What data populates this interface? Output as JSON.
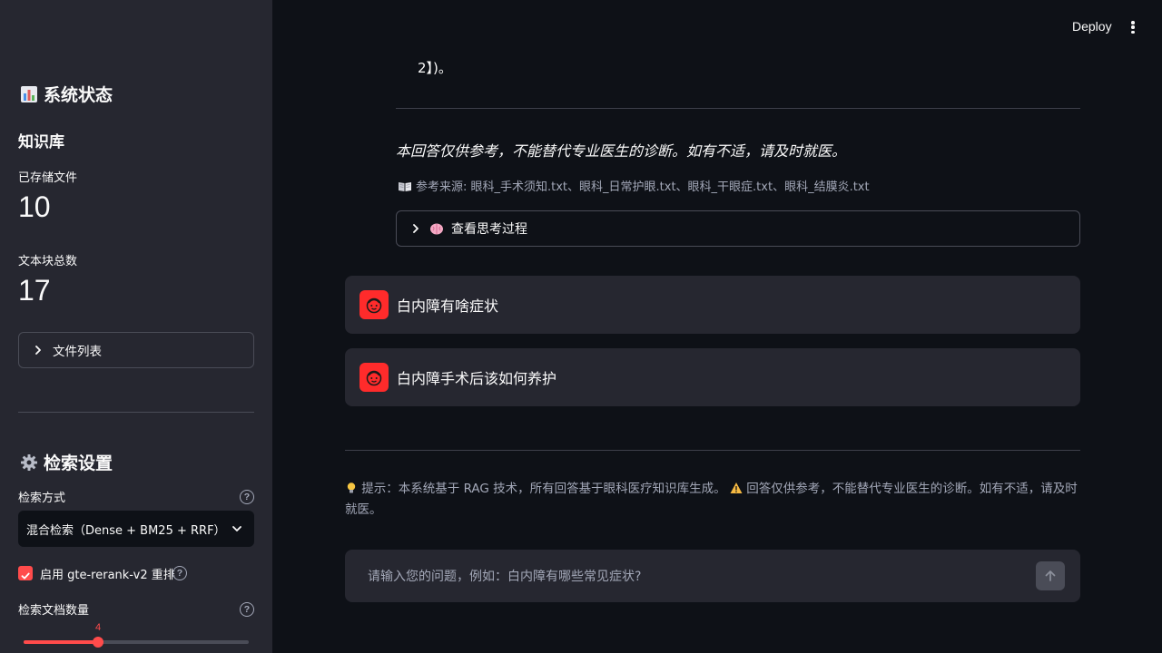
{
  "sidebar": {
    "status_title": "系统状态",
    "kb_title": "知识库",
    "stored_files_label": "已存储文件",
    "stored_files_value": "10",
    "chunks_label": "文本块总数",
    "chunks_value": "17",
    "file_list_label": "文件列表",
    "search_settings_title": "检索设置",
    "search_mode_label": "检索方式",
    "search_mode_value": "混合检索（Dense + BM25 + RRF）",
    "rerank_label": "启用 gte-rerank-v2 重排",
    "rerank_checked": true,
    "doc_count_label": "检索文档数量",
    "doc_count_value": "4",
    "doc_count_fraction": 0.33,
    "help_glyph": "?",
    "icons": {
      "status": "bar-chart-icon",
      "settings": "gear-icon"
    }
  },
  "header": {
    "deploy_label": "Deploy"
  },
  "main": {
    "continued_text": "2】)。",
    "disclaimer": "本回答仅供参考，不能替代专业医生的诊断。如有不适，请及时就医。",
    "sources_text": "参考来源: 眼科_手术须知.txt、眼科_日常护眼.txt、眼科_干眼症.txt、眼科_结膜炎.txt",
    "thinking_label": "查看思考过程",
    "messages": [
      {
        "role": "user",
        "text": "白内障有啥症状"
      },
      {
        "role": "user",
        "text": "白内障手术后该如何养护"
      }
    ],
    "tip_prefix": "提示：本系统基于 RAG 技术，所有回答基于眼科医疗知识库生成。",
    "tip_suffix": "回答仅供参考，不能替代专业医生的诊断。如有不适，请及时就医。",
    "input_placeholder": "请输入您的问题，例如：白内障有哪些常见症状?"
  },
  "colors": {
    "primary": "#ff4b4b",
    "sidebar_bg": "#262730",
    "main_bg": "#0e1117",
    "avatar_bg": "#ff2b2b"
  }
}
